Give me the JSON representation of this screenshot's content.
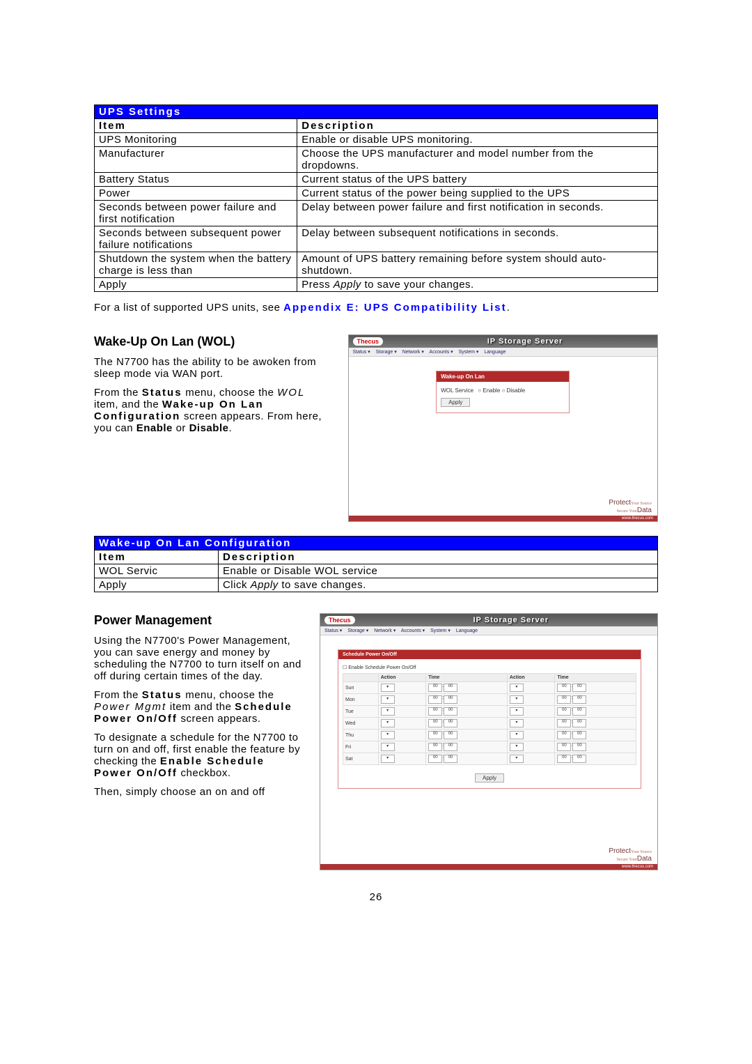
{
  "ups_table": {
    "header": "UPS Settings",
    "col_item": "Item",
    "col_desc": "Description",
    "rows": [
      {
        "item": "UPS Monitoring",
        "desc": "Enable or disable UPS monitoring."
      },
      {
        "item": "Manufacturer",
        "desc": "Choose the UPS manufacturer and model number from the dropdowns."
      },
      {
        "item": "Battery Status",
        "desc": "Current status of the UPS battery"
      },
      {
        "item": "Power",
        "desc": "Current status of the power being supplied to the UPS"
      },
      {
        "item": "Seconds between power failure and first notification",
        "desc": "Delay between power failure and first notification in seconds."
      },
      {
        "item": "Seconds between subsequent power failure notifications",
        "desc": "Delay between subsequent notifications in seconds."
      },
      {
        "item": "Shutdown the system when the battery charge is less than",
        "desc": "Amount of UPS battery remaining before system should auto-shutdown."
      },
      {
        "item": "Apply",
        "desc_pre": "Press ",
        "desc_em": "Apply",
        "desc_post": " to save your changes."
      }
    ]
  },
  "ups_note_pre": "For a list of supported UPS units, see ",
  "ups_note_link": "Appendix E: UPS Compatibility List",
  "ups_note_post": ".",
  "wol": {
    "heading": "Wake-Up On Lan (WOL)",
    "p1": "The N7700 has the ability to be awoken from sleep mode via WAN port.",
    "p2_pre": "From the ",
    "p2_b1": "Status",
    "p2_mid1": " menu, choose the ",
    "p2_i": "WOL",
    "p2_mid2": " item, and the ",
    "p2_b2": "Wake-up On Lan Configuration",
    "p2_mid3": " screen appears. From here, you can ",
    "p2_b3": "Enable",
    "p2_mid4": " or ",
    "p2_b4": "Disable",
    "p2_post": "."
  },
  "wol_screenshot": {
    "brand": "Thecus",
    "title": "IP Storage Server",
    "menu": [
      "Status ▾",
      "Storage ▾",
      "Network ▾",
      "Accounts ▾",
      "System ▾",
      "Language"
    ],
    "panel_head": "Wake-up On Lan",
    "label": "WOL Service",
    "opt1": "Enable",
    "opt2": "Disable",
    "apply": "Apply",
    "footer1": "Protect",
    "footer2": "Your Source",
    "footer3": "Secure Your",
    "footer4": "Data",
    "url": "www.thecus.com"
  },
  "wol_table": {
    "header": "Wake-up On Lan Configuration",
    "col_item": "Item",
    "col_desc": "Description",
    "rows": [
      {
        "item": "WOL Servic",
        "desc": "Enable or Disable WOL service"
      },
      {
        "item": "Apply",
        "desc_pre": "Click ",
        "desc_em": "Apply",
        "desc_post": " to save changes."
      }
    ]
  },
  "pm": {
    "heading": "Power Management",
    "p1": "Using the N7700's Power Management, you can save energy and money by scheduling the N7700 to turn itself on and off during certain times of the day.",
    "p2_pre": "From the ",
    "p2_b1": "Status",
    "p2_mid1": " menu, choose the ",
    "p2_i": "Power Mgmt",
    "p2_mid2": " item and the ",
    "p2_b2": "Schedule Power On/Off",
    "p2_post": " screen appears.",
    "p3_pre": "To designate a schedule for the N7700 to turn on and off, first enable the feature by checking the ",
    "p3_b": "Enable Schedule Power On/Off",
    "p3_post": " checkbox.",
    "p4": "Then, simply choose an on and off"
  },
  "pm_screenshot": {
    "brand": "Thecus",
    "title": "IP Storage Server",
    "menu": [
      "Status ▾",
      "Storage ▾",
      "Network ▾",
      "Accounts ▾",
      "System ▾",
      "Language"
    ],
    "panel_head": "Schedule Power On/Off",
    "checkbox_label": "Enable Schedule Power On/Off",
    "cols": [
      "",
      "Action",
      "Time",
      "Action",
      "Time"
    ],
    "days": [
      "Sun",
      "Mon",
      "Tue",
      "Wed",
      "Thu",
      "Fri",
      "Sat"
    ],
    "time_h": "00",
    "time_sep": ":",
    "time_m": "00",
    "apply": "Apply",
    "footer1": "Protect",
    "footer2": "Your Source",
    "footer3": "Secure Your",
    "footer4": "Data",
    "url": "www.thecus.com"
  },
  "page_number": "26"
}
